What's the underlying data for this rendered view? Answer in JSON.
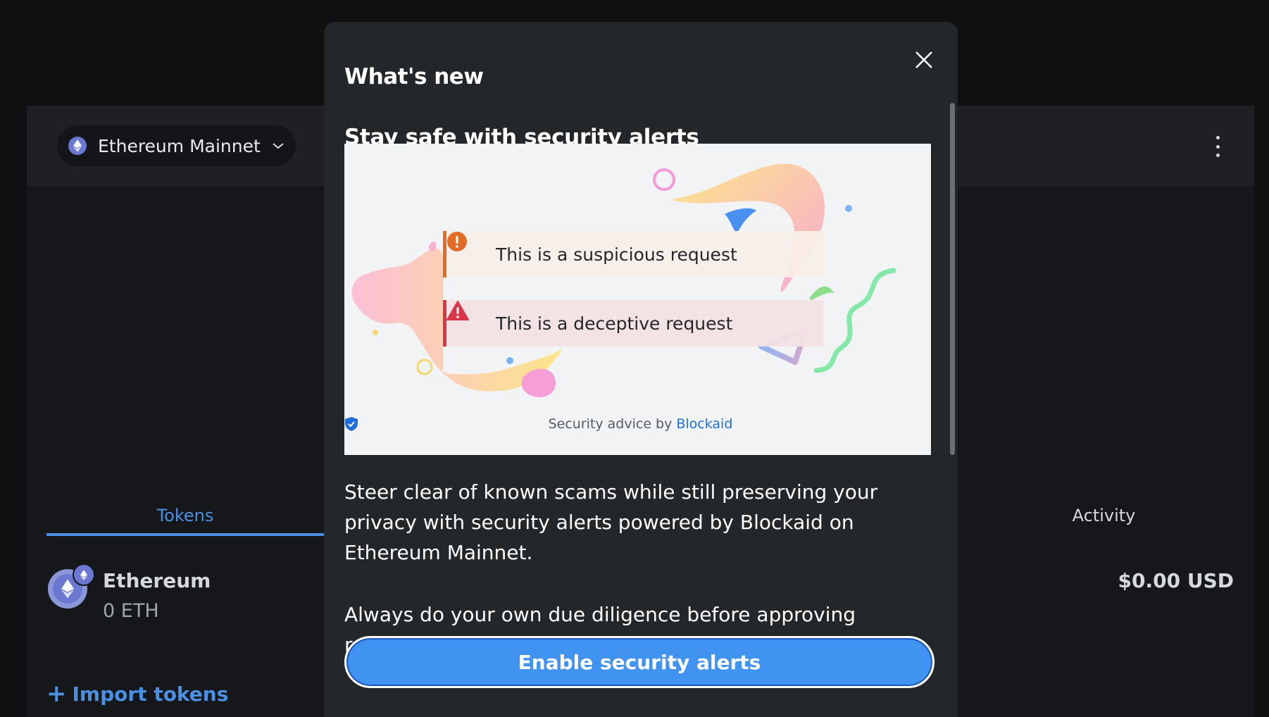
{
  "wallet": {
    "network_name": "Ethereum Mainnet",
    "tabs": {
      "tokens": "Tokens",
      "activity": "Activity"
    },
    "token": {
      "name": "Ethereum",
      "amount": "0 ETH",
      "fiat": "$0.00 USD"
    },
    "import_tokens_label": "Import tokens",
    "import_tokens_icon": "plus-icon"
  },
  "modal": {
    "title": "What's new",
    "close_icon": "close-icon",
    "section_title": "Stay safe with security alerts",
    "illustration": {
      "alerts": [
        {
          "text": "This is a suspicious request",
          "icon": "exclamation-circle-icon",
          "color": "#e26b26"
        },
        {
          "text": "This is a deceptive request",
          "icon": "warning-triangle-icon",
          "color": "#d73847"
        }
      ],
      "attribution_prefix": "Security advice by",
      "attribution_brand": "Blockaid"
    },
    "description": "Steer clear of known scams while still preserving your privacy with security alerts powered by Blockaid on Ethereum Mainnet.",
    "diligence": "Always do your own due diligence before approving requests.",
    "enable_button_label": "Enable security alerts"
  },
  "colors": {
    "accent": "#4193f2",
    "link": "#4a90e2",
    "modal_bg": "#24272a",
    "page_bg": "#0f1012"
  }
}
